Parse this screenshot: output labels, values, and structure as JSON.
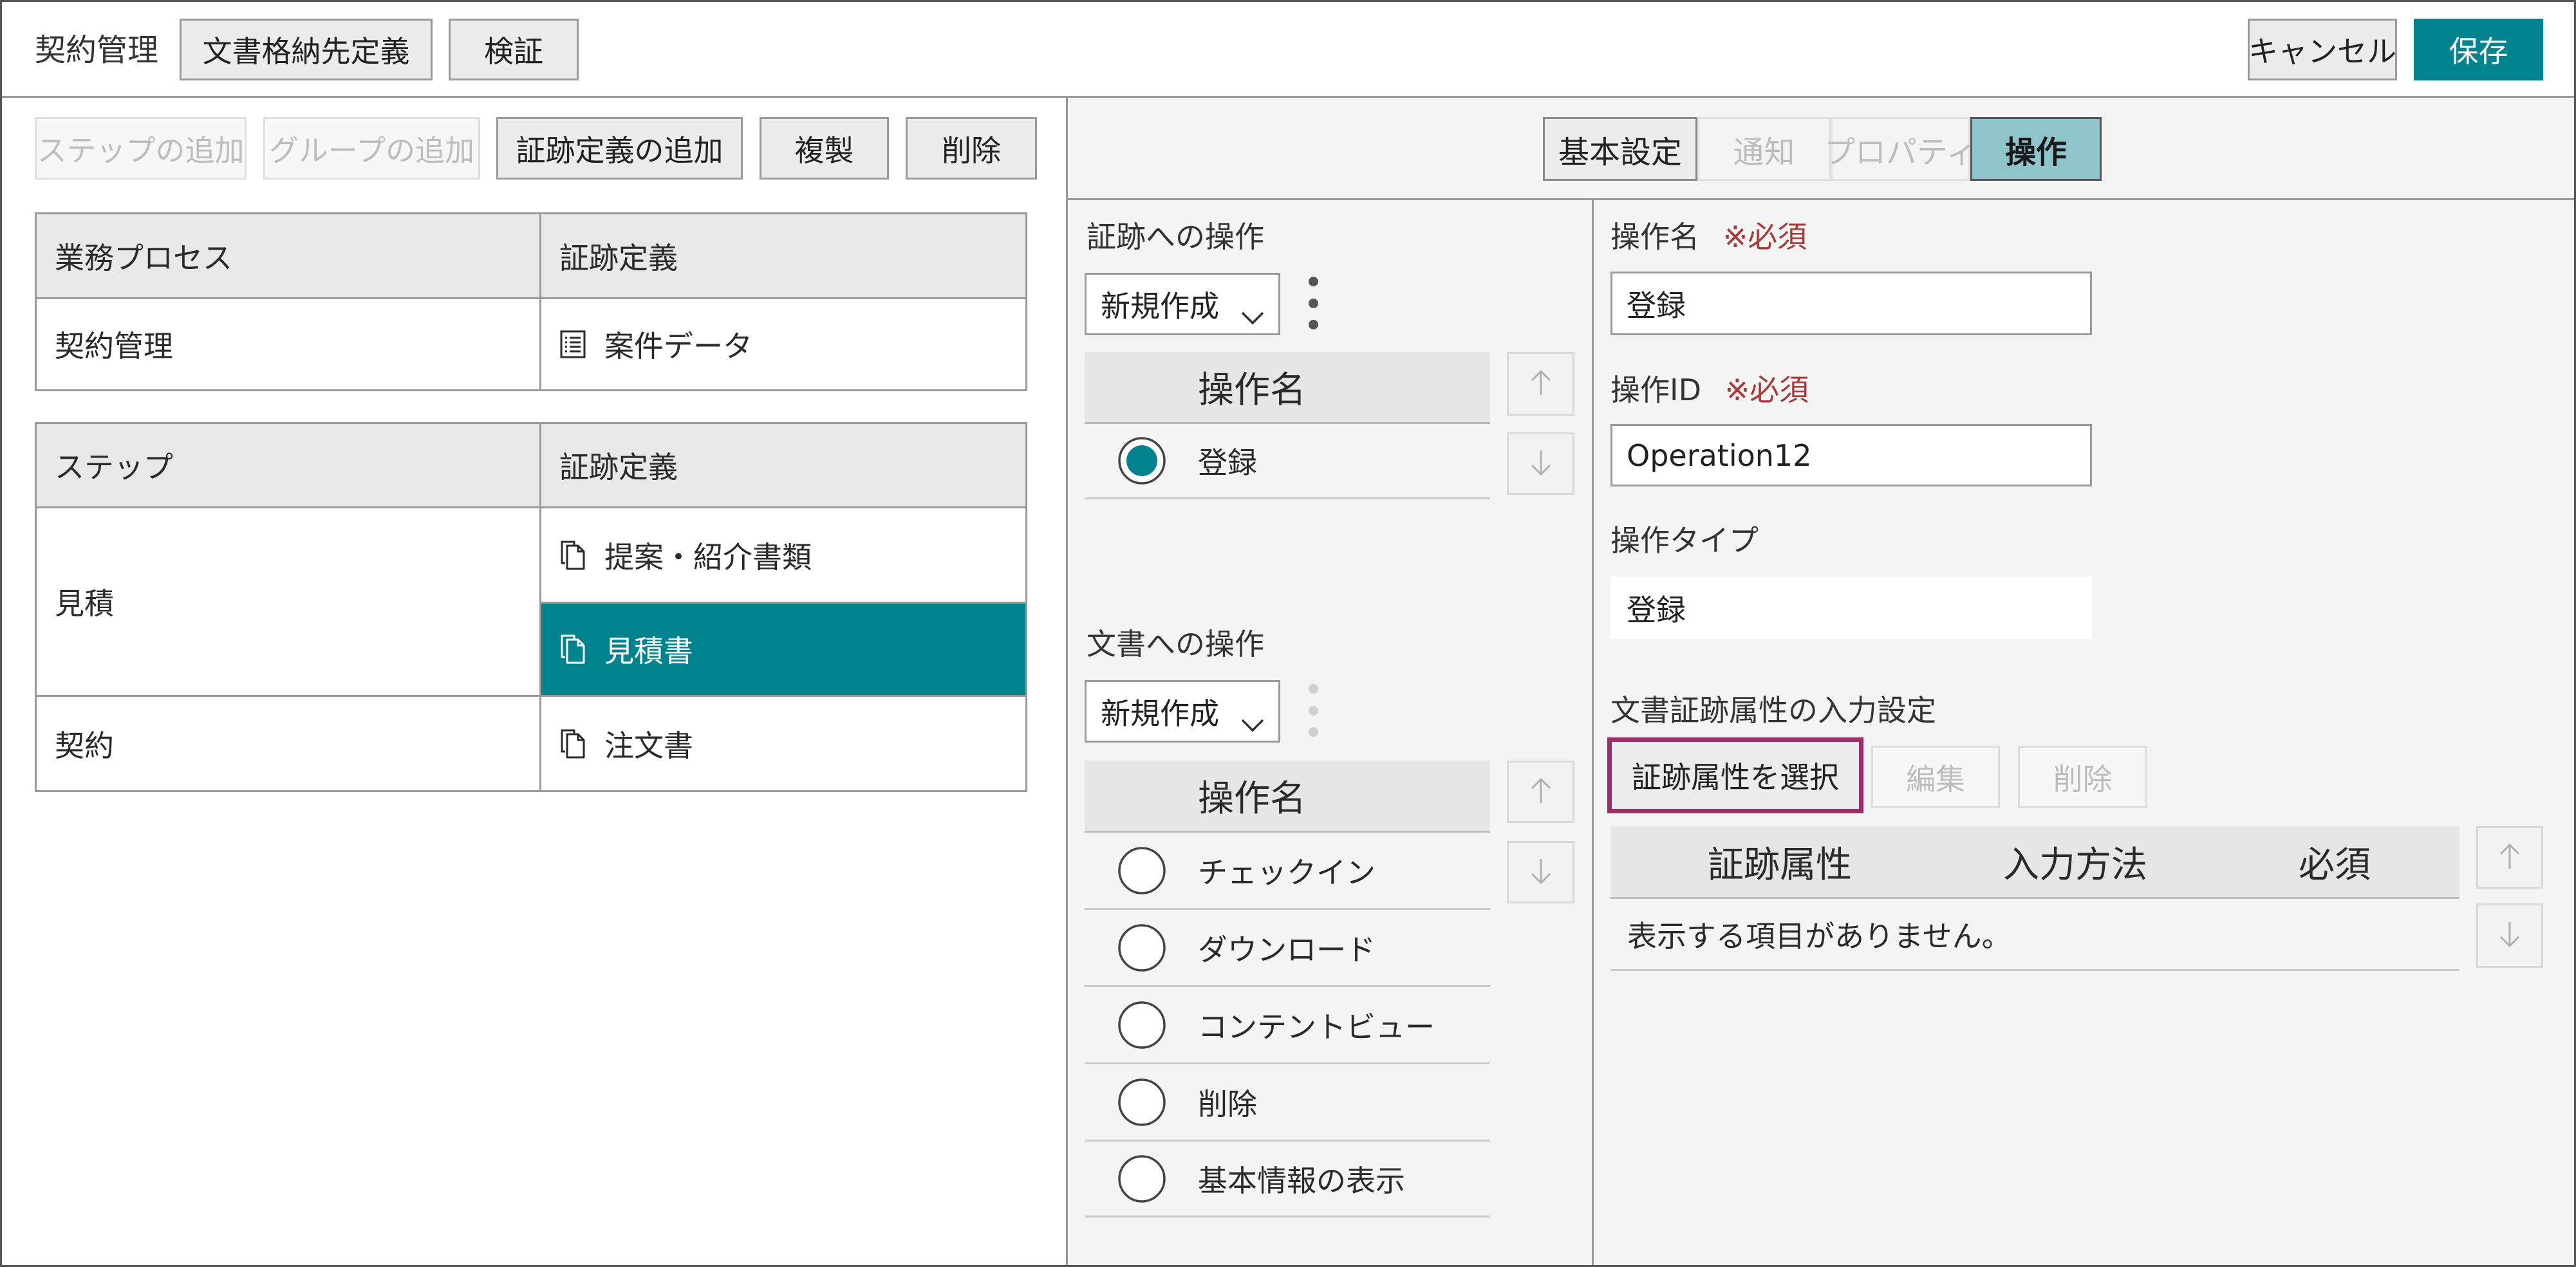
{
  "header": {
    "title": "契約管理",
    "storage_button": "文書格納先定義",
    "validate_button": "検証",
    "cancel_button": "キャンセル",
    "save_button": "保存"
  },
  "left_panel": {
    "toolbar": {
      "add_step": "ステップの追加",
      "add_group": "グループの追加",
      "add_trail_definition": "証跡定義の追加",
      "duplicate": "複製",
      "delete": "削除"
    },
    "process_table": {
      "headers": [
        "業務プロセス",
        "証跡定義"
      ],
      "rows": [
        {
          "process": "契約管理",
          "trail_definition": "案件データ",
          "icon": "list-document-icon"
        }
      ]
    },
    "step_table": {
      "headers": [
        "ステップ",
        "証跡定義"
      ],
      "rows": [
        {
          "step": "見積",
          "trail_definitions": [
            {
              "label": "提案・紹介書類",
              "icon": "documents-icon",
              "selected": false
            },
            {
              "label": "見積書",
              "icon": "documents-icon",
              "selected": true
            }
          ]
        },
        {
          "step": "契約",
          "trail_definitions": [
            {
              "label": "注文書",
              "icon": "documents-icon",
              "selected": false
            }
          ]
        }
      ]
    }
  },
  "right_panel": {
    "tabs": [
      {
        "label": "基本設定",
        "disabled": false,
        "active": false
      },
      {
        "label": "通知",
        "disabled": true,
        "active": false
      },
      {
        "label": "プロパティ",
        "disabled": true,
        "active": false
      },
      {
        "label": "操作",
        "disabled": false,
        "active": true
      }
    ],
    "trail_operations": {
      "label": "証跡への操作",
      "dropdown_value": "新規作成",
      "list_header": "操作名",
      "items": [
        {
          "label": "登録",
          "selected": true
        }
      ]
    },
    "document_operations": {
      "label": "文書への操作",
      "dropdown_value": "新規作成",
      "list_header": "操作名",
      "items": [
        {
          "label": "チェックイン",
          "selected": false
        },
        {
          "label": "ダウンロード",
          "selected": false
        },
        {
          "label": "コンテントビュー",
          "selected": false
        },
        {
          "label": "削除",
          "selected": false
        },
        {
          "label": "基本情報の表示",
          "selected": false
        }
      ]
    },
    "operation_form": {
      "name_label": "操作名",
      "name_required": "※必須",
      "name_value": "登録",
      "id_label": "操作ID",
      "id_required": "※必須",
      "id_value": "Operation12",
      "type_label": "操作タイプ",
      "type_value": "登録",
      "attr_section_label": "文書証跡属性の入力設定",
      "select_attr_button": "証跡属性を選択",
      "edit_button": "編集",
      "delete_button": "削除",
      "attr_table": {
        "headers": [
          "証跡属性",
          "入力方法",
          "必須"
        ],
        "empty_message": "表示する項目がありません。"
      }
    }
  },
  "colors": {
    "accent": "#00838c",
    "active_tab": "#8ec4ca",
    "required_text": "#a83a3a",
    "highlight_outline": "#9c2e69"
  }
}
